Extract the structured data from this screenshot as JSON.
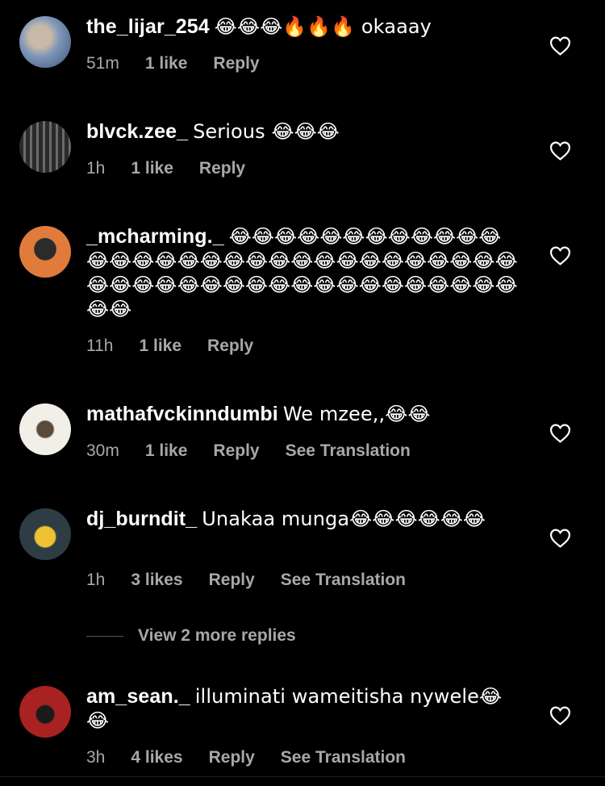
{
  "comments": [
    {
      "username": "the_lijar_254",
      "text": "😂😂😂🔥🔥🔥 okaaay",
      "time": "51m",
      "likes": "1 like",
      "reply": "Reply",
      "translation": "",
      "avatar_color": "#6f8fb3"
    },
    {
      "username": "blvck.zee_",
      "text": "Serious 😂😂😂",
      "time": "1h",
      "likes": "1 like",
      "reply": "Reply",
      "translation": "",
      "avatar_color": "#5a5a5a"
    },
    {
      "username": "_mcharming._",
      "text": "😂😂😂😂😂😂😂😂😂😂😂😂😂😂😂😂😂😂😂😂😂😂😂😂😂😂😂😂😂😂😂😂😂😂😂😂😂😂😂😂😂😂😂😂😂😂😂😂😂😂😂😂",
      "time": "11h",
      "likes": "1 like",
      "reply": "Reply",
      "translation": "",
      "avatar_color": "#d8743a"
    },
    {
      "username": "mathafvckinndumbi",
      "text": "We mzee,,😂😂",
      "time": "30m",
      "likes": "1 like",
      "reply": "Reply",
      "translation": "See Translation",
      "avatar_color": "#e9e4dc"
    },
    {
      "username": "dj_burndit_",
      "text": "Unakaa munga😂😂😂😂😂😂",
      "time": "1h",
      "likes": "3 likes",
      "reply": "Reply",
      "translation": "See Translation",
      "avatar_color": "#3b4a52"
    },
    {
      "username": "am_sean._",
      "text": "illuminati wameitisha nywele😂😂",
      "time": "3h",
      "likes": "4 likes",
      "reply": "Reply",
      "translation": "See Translation",
      "avatar_color": "#9a1f1f"
    }
  ],
  "view_replies": "View 2 more replies",
  "colors": {
    "background": "#000000",
    "text": "#ffffff",
    "meta": "#a8a8a8"
  }
}
